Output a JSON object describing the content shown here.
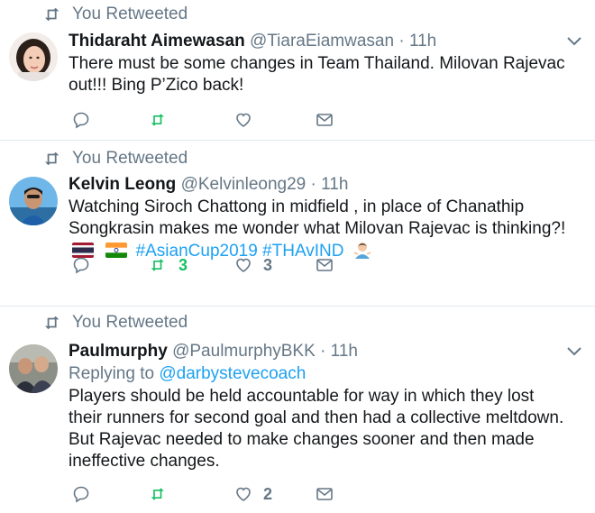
{
  "feed": {
    "tweets": [
      {
        "retweet_label": "You Retweeted",
        "name": "Thidaraht Aimewasan",
        "handle": "@TiaraEiamwasan",
        "time": "· 11h",
        "reply_prefix": "",
        "reply_mention": "",
        "text": "There must be some changes in Team Thailand. Milovan Rajevac out!!! Bing P’Zico back!",
        "retweet_count": "",
        "like_count": ""
      },
      {
        "retweet_label": "You Retweeted",
        "name": "Kelvin Leong",
        "handle": "@Kelvinleong29",
        "time": "· 11h",
        "reply_prefix": "",
        "reply_mention": "",
        "text": "Watching Siroch Chattong in midfield , in place of Chanathip Songkrasin makes me wonder what Milovan Rajevac is thinking?!",
        "hashtags": "#AsianCup2019 #THAvIND",
        "retweet_count": "3",
        "like_count": "3"
      },
      {
        "retweet_label": "You Retweeted",
        "name": "Paulmurphy",
        "handle": "@PaulmurphyBKK",
        "time": "· 11h",
        "reply_prefix": "Replying to ",
        "reply_mention": "@darbystevecoach",
        "text": "Players should be held accountable for way in which they lost their runners for second goal and then had a collective meltdown. But Rajevac needed to make changes sooner and then made ineffective changes.",
        "retweet_count": "",
        "like_count": "2"
      }
    ]
  },
  "colors": {
    "text": "#14171a",
    "secondary": "#657786",
    "link": "#1da1f2",
    "retweet_green": "#17bf63",
    "divider": "#e1e8ed"
  },
  "icons": [
    "retweet-icon",
    "reply-icon",
    "like-icon",
    "direct-message-icon",
    "caret-down-icon"
  ]
}
